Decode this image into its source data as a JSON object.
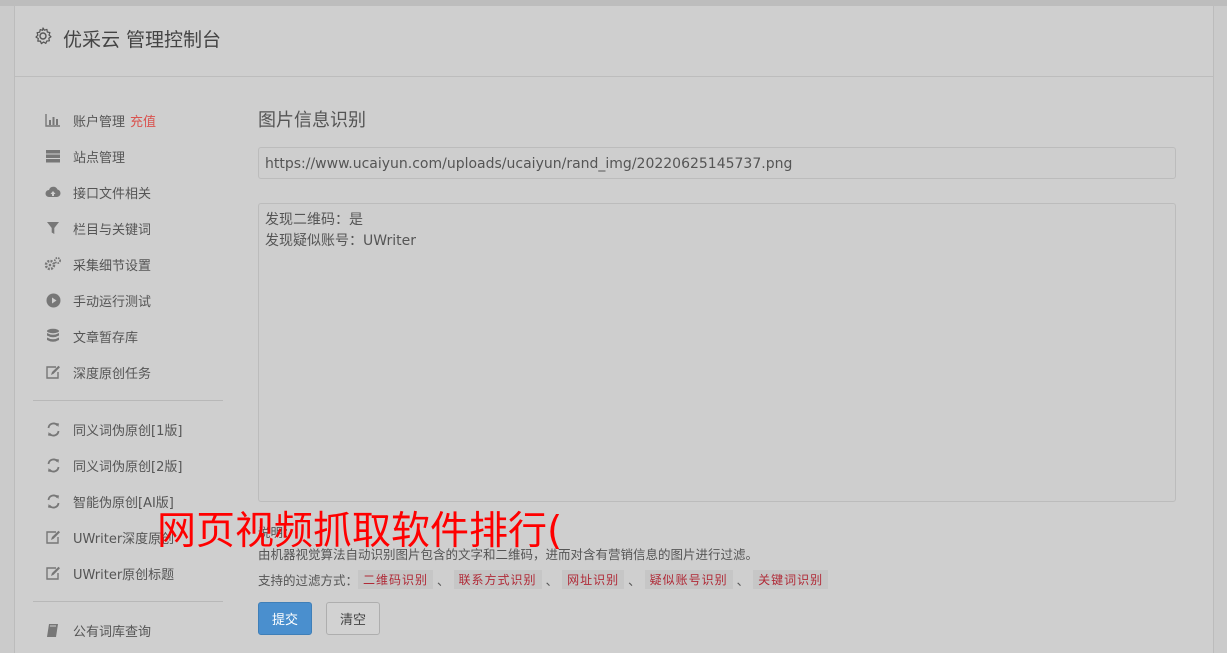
{
  "header": {
    "title": "优采云 管理控制台",
    "icon": "gear-icon"
  },
  "sidebar": {
    "groups": [
      [
        {
          "label": "账户管理",
          "badge": "充值",
          "icon": "bar-chart-icon"
        },
        {
          "label": "站点管理",
          "icon": "server-icon"
        },
        {
          "label": "接口文件相关",
          "icon": "cloud-upload-icon"
        },
        {
          "label": "栏目与关键词",
          "icon": "filter-icon"
        },
        {
          "label": "采集细节设置",
          "icon": "cogs-icon"
        },
        {
          "label": "手动运行测试",
          "icon": "play-circle-icon"
        },
        {
          "label": "文章暂存库",
          "icon": "database-icon"
        },
        {
          "label": "深度原创任务",
          "icon": "edit-icon"
        }
      ],
      [
        {
          "label": "同义词伪原创[1版]",
          "icon": "refresh-icon"
        },
        {
          "label": "同义词伪原创[2版]",
          "icon": "refresh-icon"
        },
        {
          "label": "智能伪原创[AI版]",
          "icon": "refresh-icon"
        },
        {
          "label": "UWriter深度原创",
          "icon": "edit-icon"
        },
        {
          "label": "UWriter原创标题",
          "icon": "edit-icon"
        }
      ],
      [
        {
          "label": "公有词库查询",
          "icon": "book-icon"
        }
      ]
    ]
  },
  "main": {
    "title": "图片信息识别",
    "url_value": "https://www.ucaiyun.com/uploads/ucaiyun/rand_img/20220625145737.png",
    "result_lines": [
      "发现二维码：是",
      "发现疑似账号：UWriter"
    ],
    "help_label": "说明：",
    "help_text": "由机器视觉算法自动识别图片包含的文字和二维码，进而对含有营销信息的图片进行过滤。",
    "filters_label": "支持的过滤方式：",
    "filter_tags": [
      "二维码识别",
      "联系方式识别",
      "网址识别",
      "疑似账号识别",
      "关键词识别"
    ],
    "filter_separator": "、",
    "submit_label": "提交",
    "clear_label": "清空"
  },
  "watermark": "网页视频抓取软件排行(",
  "colors": {
    "accent": "#4a8fce",
    "badge": "#d9534f",
    "tag_text": "#b02a37",
    "watermark": "#ff0000"
  }
}
